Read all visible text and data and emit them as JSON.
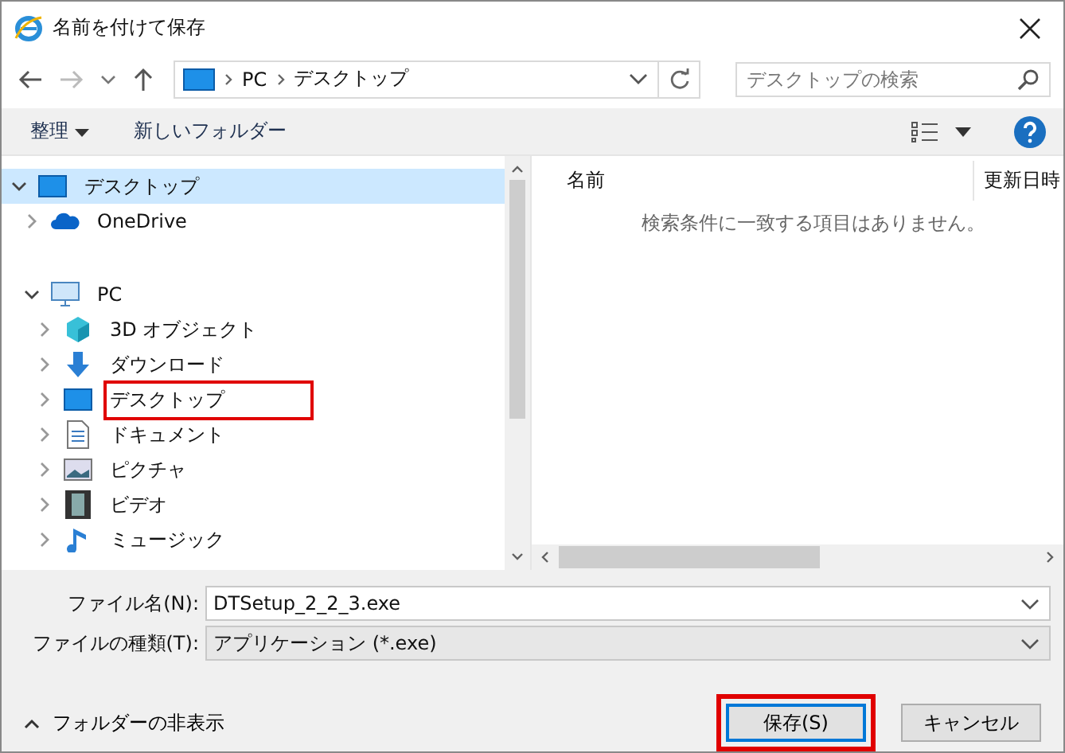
{
  "window": {
    "title": "名前を付けて保存"
  },
  "address": {
    "path": [
      "PC",
      "デスクトップ"
    ]
  },
  "search": {
    "placeholder": "デスクトップの検索"
  },
  "toolbar": {
    "organize": "整理",
    "new_folder": "新しいフォルダー"
  },
  "tree": [
    {
      "label": "デスクトップ",
      "kind": "desktop",
      "expanded": true,
      "selected": true,
      "highlighted": false,
      "children": [
        {
          "label": "OneDrive",
          "kind": "cloud",
          "expanded": false,
          "selected": false,
          "highlighted": false
        },
        {
          "label": "PC",
          "kind": "pc",
          "expanded": true,
          "selected": false,
          "highlighted": false,
          "children": [
            {
              "label": "3D オブジェクト",
              "kind": "cube",
              "expanded": false,
              "selected": false,
              "highlighted": false
            },
            {
              "label": "ダウンロード",
              "kind": "download",
              "expanded": false,
              "selected": false,
              "highlighted": false
            },
            {
              "label": "デスクトップ",
              "kind": "desktop",
              "expanded": false,
              "selected": false,
              "highlighted": true
            },
            {
              "label": "ドキュメント",
              "kind": "document",
              "expanded": false,
              "selected": false,
              "highlighted": false
            },
            {
              "label": "ピクチャ",
              "kind": "picture",
              "expanded": false,
              "selected": false,
              "highlighted": false
            },
            {
              "label": "ビデオ",
              "kind": "video",
              "expanded": false,
              "selected": false,
              "highlighted": false
            },
            {
              "label": "ミュージック",
              "kind": "music",
              "expanded": false,
              "selected": false,
              "highlighted": false
            }
          ]
        }
      ]
    }
  ],
  "list": {
    "columns": [
      "名前",
      "更新日時"
    ],
    "empty_message": "検索条件に一致する項目はありません。"
  },
  "filename": {
    "label": "ファイル名(N):",
    "value": "DTSetup_2_2_3.exe"
  },
  "filetype": {
    "label": "ファイルの種類(T):",
    "value": "アプリケーション (*.exe)"
  },
  "hide_folders": "フォルダーの非表示",
  "buttons": [
    {
      "label": "保存(S)",
      "kind": "primary",
      "highlighted": true
    },
    {
      "label": "キャンセル",
      "kind": "normal",
      "highlighted": false
    }
  ]
}
